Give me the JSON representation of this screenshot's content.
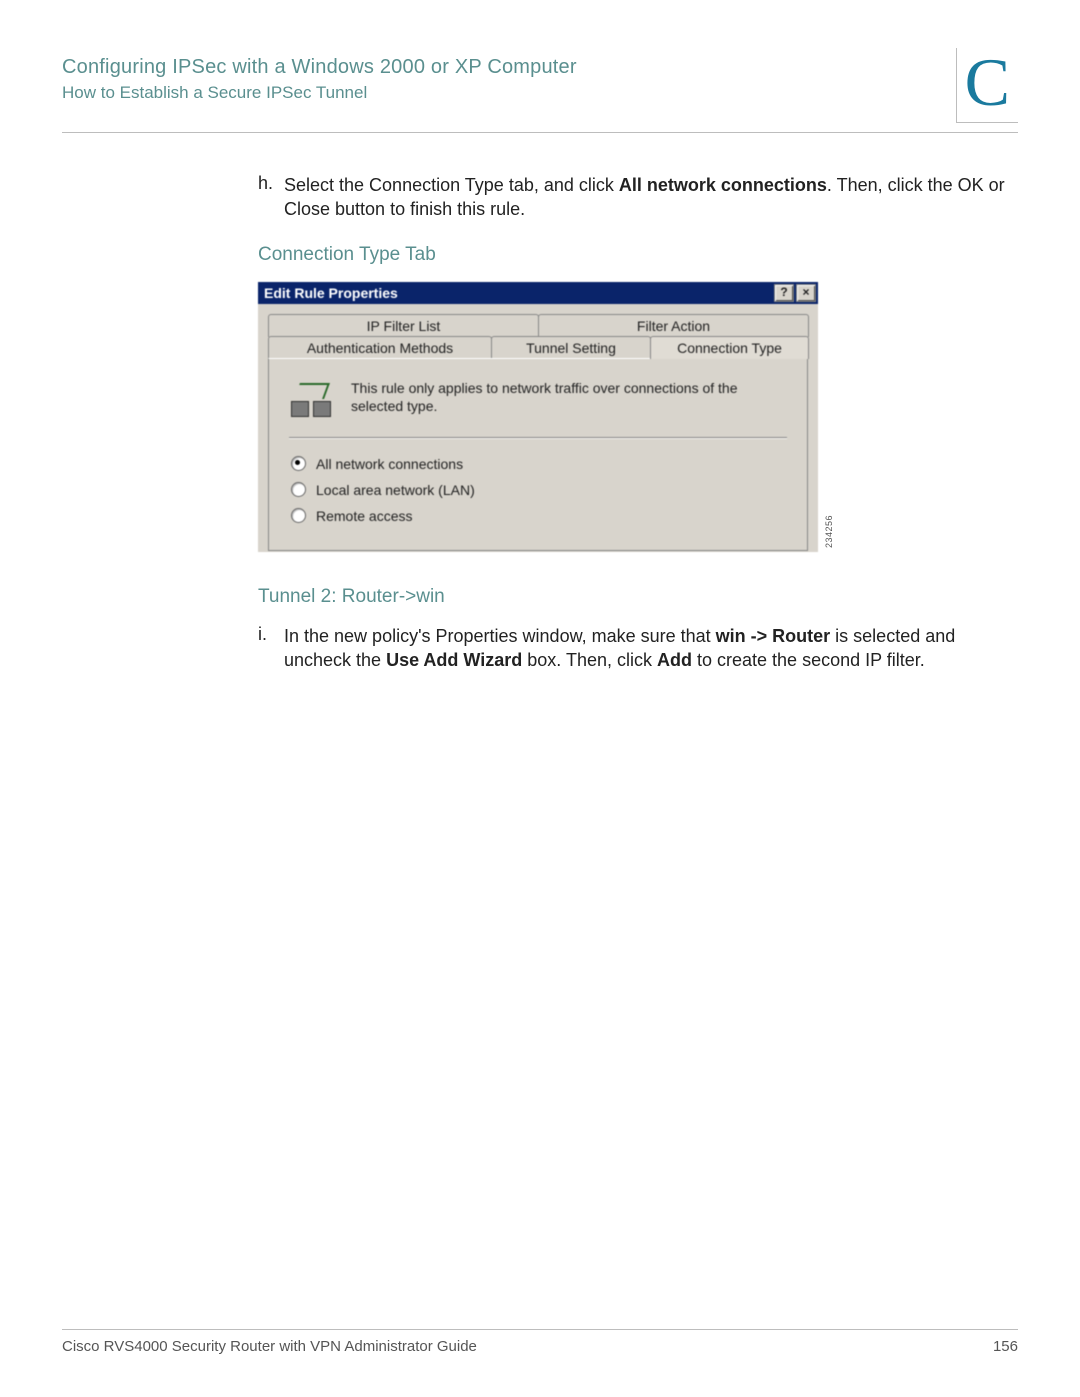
{
  "header": {
    "chapter_title": "Configuring IPSec with a Windows 2000 or XP Computer",
    "section_title": "How to Establish a Secure IPSec Tunnel",
    "appendix_letter": "C"
  },
  "step_h": {
    "letter": "h.",
    "prefix": "Select the Connection Type tab, and click ",
    "bold": "All network connections",
    "suffix": ". Then, click the OK or Close button to finish this rule."
  },
  "fig1_caption": "Connection Type Tab",
  "dialog": {
    "title": "Edit Rule Properties",
    "help_btn": "?",
    "close_btn": "×",
    "tabs_row1": {
      "ip_filter": "IP Filter List",
      "filter_action": "Filter Action"
    },
    "tabs_row2": {
      "auth": "Authentication Methods",
      "tunnel": "Tunnel Setting",
      "conn": "Connection Type"
    },
    "description": "This rule only applies to network traffic over connections of the selected type.",
    "radios": {
      "all": "All network connections",
      "lan": "Local area network (LAN)",
      "remote": "Remote access"
    },
    "figure_id": "234256"
  },
  "section2_heading": "Tunnel 2: Router->win",
  "step_i": {
    "letter": "i.",
    "part1": "In the new policy's Properties window, make sure that ",
    "bold1": "win -> Router",
    "part2": " is selected and uncheck the ",
    "bold2": "Use Add Wizard",
    "part3": " box. Then, click ",
    "bold3": "Add",
    "part4": " to create the second IP filter."
  },
  "footer": {
    "guide": "Cisco RVS4000 Security Router with VPN Administrator Guide",
    "page": "156"
  }
}
